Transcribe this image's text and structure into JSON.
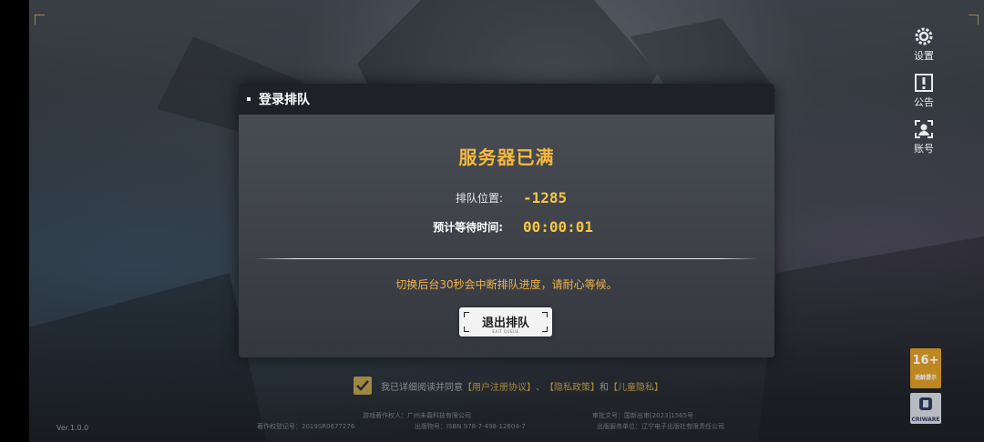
{
  "dialog": {
    "title": "登录排队",
    "headline": "服务器已满",
    "queue_label": "排队位置:",
    "queue_value": "-1285",
    "wait_label": "预计等待时间:",
    "wait_value": "00:00:01",
    "notice": "切换后台30秒会中断排队进度，请耐心等候。",
    "exit_label": "退出排队",
    "exit_sub": "EXIT QUEUE"
  },
  "side_menu": [
    {
      "label": "设置",
      "icon": "gear-icon"
    },
    {
      "label": "公告",
      "icon": "notice-icon"
    },
    {
      "label": "账号",
      "icon": "account-icon"
    }
  ],
  "footer": {
    "agree_prefix": "我已详细阅读并同意",
    "link_user": "【用户注册协议】",
    "sep1": "、",
    "link_privacy": "【隐私政策】",
    "sep2": "和",
    "link_child": "【儿童隐私】",
    "copyright_owner": "游戏著作权人：广州未羲科技有限公司",
    "approval_no": "审批文号：国新出审[2023]1565号",
    "reg_no": "著作权登记号：2019SR0677276",
    "isbn": "出版物号：ISBN 978-7-498-12604-7",
    "publisher": "出版服务单位：辽宁电子出版社有限责任公司",
    "version": "Ver.1.0.0",
    "rating_num": "16+",
    "rating_text": "适龄提示",
    "cri_text": "CRIWARE"
  },
  "colors": {
    "accent": "#f6b83e",
    "panel": "#42464c",
    "header": "#1f2126"
  }
}
